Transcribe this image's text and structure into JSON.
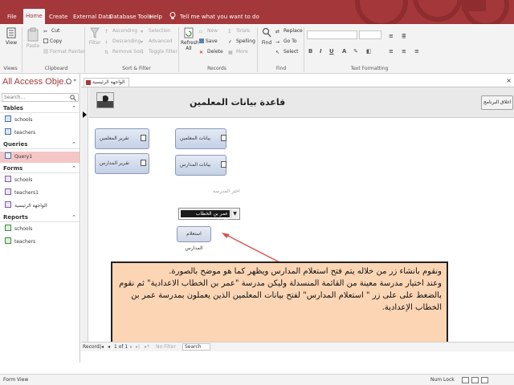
{
  "menubar": {
    "tabs": [
      "File",
      "Home",
      "Create",
      "External Data",
      "Database Tools",
      "Help"
    ],
    "active_tab": "Home",
    "tell_me": "Tell me what you want to do",
    "accent_color": "#a4373a"
  },
  "ribbon": {
    "views": {
      "view": "View",
      "group": "Views"
    },
    "clipboard": {
      "paste": "Paste",
      "cut": "Cut",
      "copy": "Copy",
      "format_painter": "Format Painter",
      "group": "Clipboard"
    },
    "sort_filter": {
      "filter": "Filter",
      "ascending": "Ascending",
      "descending": "Descending",
      "remove_sort": "Remove Sort",
      "selection": "Selection",
      "advanced": "Advanced",
      "toggle_filter": "Toggle Filter",
      "group": "Sort & Filter"
    },
    "records": {
      "refresh_all": "Refresh All",
      "new": "New",
      "save": "Save",
      "delete": "Delete",
      "totals": "Totals",
      "spelling": "Spelling",
      "more": "More",
      "group": "Records"
    },
    "find": {
      "find": "Find",
      "replace": "Replace",
      "go_to": "Go To",
      "select": "Select",
      "group": "Find"
    },
    "text_formatting": {
      "group": "Text Formatting"
    }
  },
  "nav": {
    "title": "All Access Obje...",
    "search_placeholder": "Search...",
    "sections": {
      "tables": {
        "label": "Tables",
        "items": [
          "schools",
          "teachers"
        ]
      },
      "queries": {
        "label": "Queries",
        "items": [
          "Query1"
        ]
      },
      "forms": {
        "label": "Forms",
        "items": [
          "schools",
          "teachers1",
          "الواجهة الرئيسية"
        ]
      },
      "reports": {
        "label": "Reports",
        "items": [
          "schools",
          "teachers"
        ]
      }
    },
    "selected_item": "Query1"
  },
  "doc": {
    "tab_label": "الواجهة الرئيسية",
    "header_title": "قاعدة بيانات المعلمين",
    "close_form_button": "اغلاق البرنامج",
    "buttons": {
      "teachers_data": "بيانات المعلمين",
      "schools_data": "بيانات المدارس",
      "teachers_report": "تقرير المعلمين",
      "schools_report": "تقرير المدارس"
    },
    "choose_school_label": "اختر المدرسة",
    "school_combo_value": "عمر بن الخطاب الإعدادية",
    "query_button": "استعلام المدارس"
  },
  "annotation": {
    "lines": [
      "ونقوم بانشاء زر من خلاله يتم فتح استعلام المدارس ويظهر كما هو موضح بالصورة.",
      "وعند اختيار مدرسة معينة من القائمة المنسدلة وليكن مدرسة \"عمر بن الخطاب الاعدادية\" ثم نقوم بالضغط على على زر \" استعلام المدارس\" لفتح بيانات المعلمين الذين يعملون بمدرسة عمر بن الخطاب الإعدادية."
    ]
  },
  "record_nav": {
    "label": "Record:",
    "position": "1 of 1",
    "filter": "No Filter",
    "search": "Search"
  },
  "status": {
    "left": "Form View",
    "num_lock": "Num Lock"
  }
}
